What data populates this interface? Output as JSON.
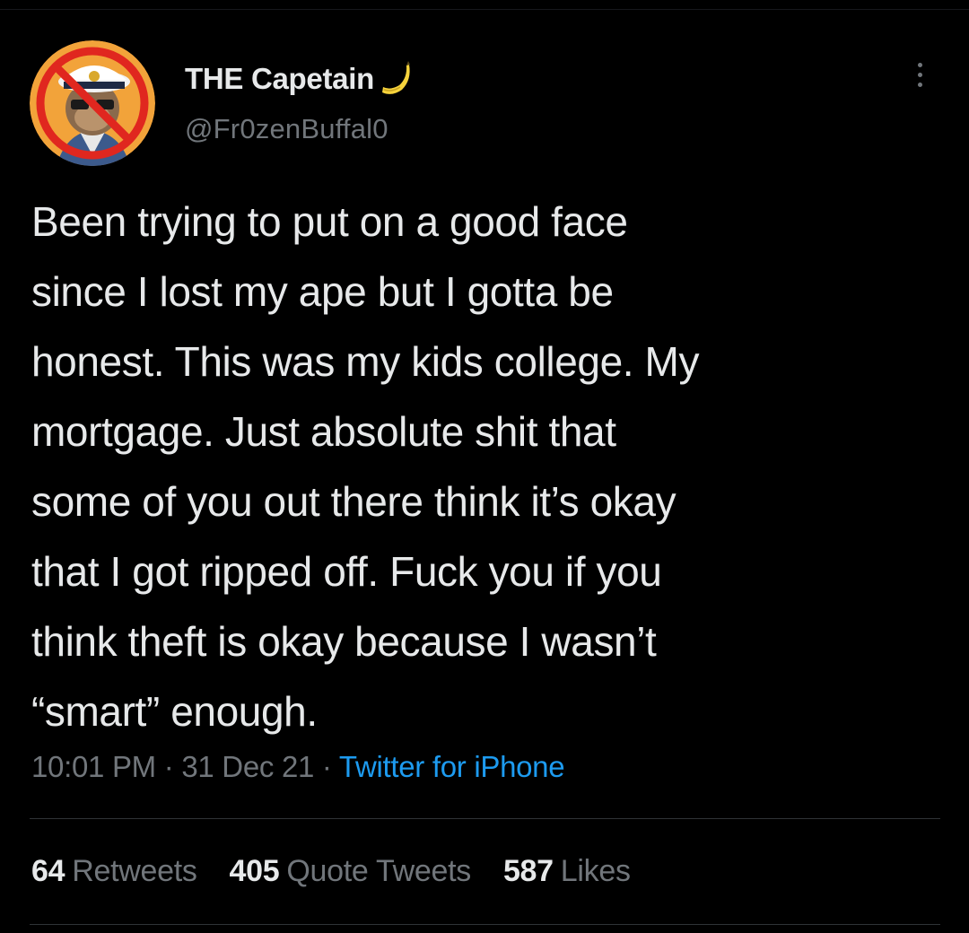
{
  "tweet": {
    "author": {
      "display_name": "THE Capetain",
      "name_emoji": "banana-icon",
      "handle": "@Fr0zenBuffal0",
      "avatar": "ape-with-captain-hat-crossed-out"
    },
    "text_lines": [
      "Been trying to put on a good face",
      "since I lost my ape but I gotta be",
      "honest. This was my kids college. My",
      "mortgage. Just absolute shit that",
      "some of you out there think it’s okay",
      "that I got ripped off. Fuck you if you",
      "think theft is okay because I wasn’t",
      "“smart” enough."
    ],
    "meta": {
      "time": "10:01 PM",
      "separator": "·",
      "date": "31 Dec 21",
      "source": "Twitter for iPhone"
    },
    "stats": {
      "retweets": {
        "count": "64",
        "label": "Retweets"
      },
      "quote_tweets": {
        "count": "405",
        "label": "Quote Tweets"
      },
      "likes": {
        "count": "587",
        "label": "Likes"
      }
    }
  },
  "colors": {
    "background": "#000000",
    "primary_text": "#e7e9ea",
    "secondary_text": "#71767b",
    "link": "#1d9bf0",
    "divider": "#2f3336"
  }
}
